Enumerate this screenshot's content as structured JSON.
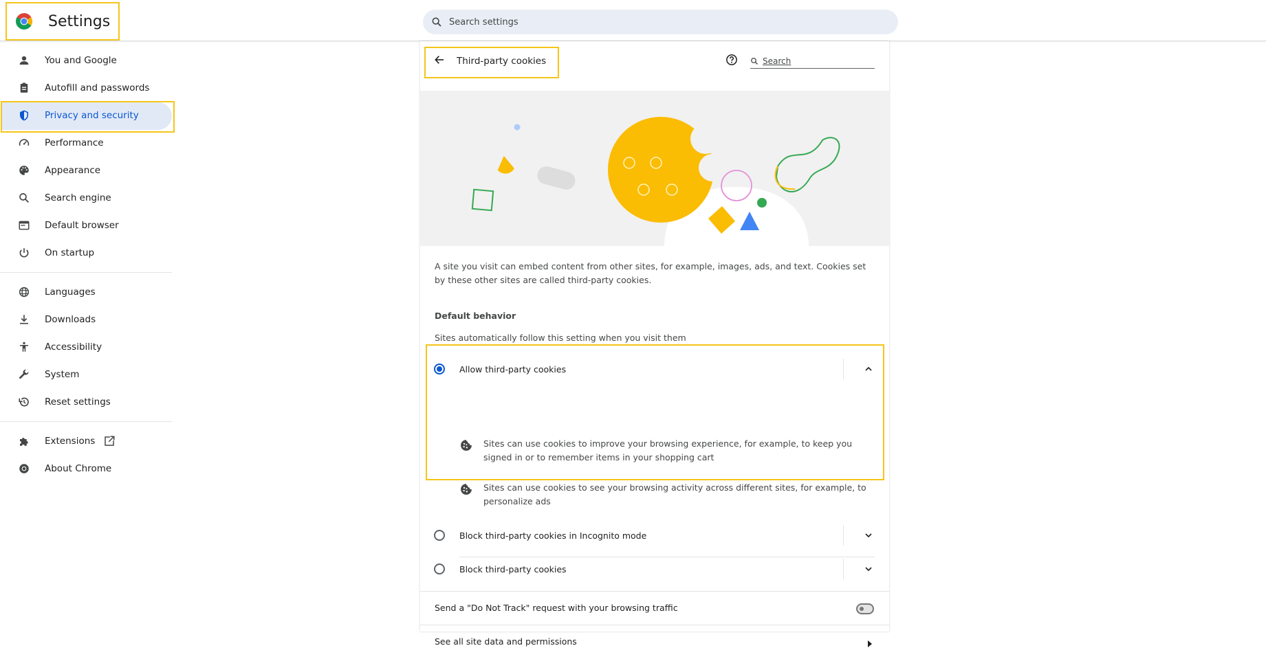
{
  "header": {
    "title": "Settings",
    "search_placeholder": "Search settings"
  },
  "sidebar": {
    "items": [
      {
        "label": "You and Google",
        "icon": "person-icon"
      },
      {
        "label": "Autofill and passwords",
        "icon": "clipboard-icon"
      },
      {
        "label": "Privacy and security",
        "icon": "shield-icon",
        "active": true
      },
      {
        "label": "Performance",
        "icon": "speedometer-icon"
      },
      {
        "label": "Appearance",
        "icon": "palette-icon"
      },
      {
        "label": "Search engine",
        "icon": "search-icon"
      },
      {
        "label": "Default browser",
        "icon": "browser-window-icon"
      },
      {
        "label": "On startup",
        "icon": "power-icon"
      },
      {
        "label": "Languages",
        "icon": "globe-icon"
      },
      {
        "label": "Downloads",
        "icon": "download-icon"
      },
      {
        "label": "Accessibility",
        "icon": "accessibility-icon"
      },
      {
        "label": "System",
        "icon": "wrench-icon"
      },
      {
        "label": "Reset settings",
        "icon": "history-icon"
      },
      {
        "label": "Extensions",
        "icon": "puzzle-icon"
      },
      {
        "label": "About Chrome",
        "icon": "chrome-icon"
      }
    ]
  },
  "panel": {
    "title": "Third-party cookies",
    "search_placeholder": "Search",
    "description": "A site you visit can embed content from other sites, for example, images, ads, and text. Cookies set by these other sites are called third-party cookies.",
    "section_title": "Default behavior",
    "section_subtitle": "Sites automatically follow this setting when you visit them",
    "options": [
      {
        "label": "Allow third-party cookies",
        "selected": true,
        "expanded": true
      },
      {
        "label": "Block third-party cookies in Incognito mode",
        "selected": false,
        "expanded": false
      },
      {
        "label": "Block third-party cookies",
        "selected": false,
        "expanded": false
      }
    ],
    "allow_details": [
      "Sites can use cookies to improve your browsing experience, for example, to keep you signed in or to remember items in your shopping cart",
      "Sites can use cookies to see your browsing activity across different sites, for example, to personalize ads"
    ],
    "do_not_track_label": "Send a \"Do Not Track\" request with your browsing traffic",
    "do_not_track_on": false,
    "site_data_label": "See all site data and permissions"
  },
  "colors": {
    "accent": "#0b57d0",
    "highlight": "#f5c518",
    "active_bg": "#e1e9f7"
  }
}
